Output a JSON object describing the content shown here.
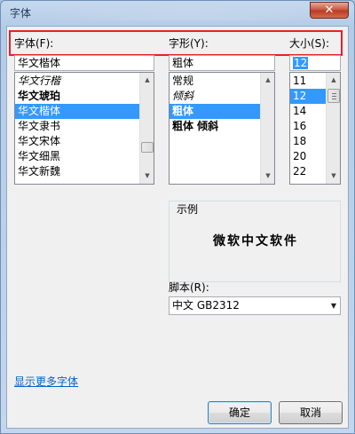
{
  "window": {
    "title": "字体",
    "close_glyph": "✕"
  },
  "labels": {
    "font": "字体(F):",
    "style": "字形(Y):",
    "size": "大小(S):",
    "preview": "示例",
    "script": "脚本(R):"
  },
  "font_input": "华文楷体",
  "style_input": "粗体",
  "size_input": "12",
  "font_list": [
    {
      "label": "华文行楷",
      "selected": false,
      "look": "script"
    },
    {
      "label": "华文琥珀",
      "selected": false,
      "look": "bold"
    },
    {
      "label": "华文楷体",
      "selected": true,
      "look": "normal"
    },
    {
      "label": "华文隶书",
      "selected": false,
      "look": "normal"
    },
    {
      "label": "华文宋体",
      "selected": false,
      "look": "normal"
    },
    {
      "label": "华文细黑",
      "selected": false,
      "look": "normal"
    },
    {
      "label": "华文新魏",
      "selected": false,
      "look": "normal"
    }
  ],
  "style_list": [
    {
      "label": "常规",
      "selected": false,
      "look": "normal"
    },
    {
      "label": "倾斜",
      "selected": false,
      "look": "script"
    },
    {
      "label": "粗体",
      "selected": true,
      "look": "bold"
    },
    {
      "label": "粗体 倾斜",
      "selected": false,
      "look": "bold"
    }
  ],
  "size_list": [
    {
      "label": "11",
      "selected": false
    },
    {
      "label": "12",
      "selected": true
    },
    {
      "label": "14",
      "selected": false
    },
    {
      "label": "16",
      "selected": false
    },
    {
      "label": "18",
      "selected": false
    },
    {
      "label": "20",
      "selected": false
    },
    {
      "label": "22",
      "selected": false
    }
  ],
  "preview_text": "微软中文软件",
  "script_value": "中文 GB2312",
  "more_fonts_link": "显示更多字体",
  "buttons": {
    "ok": "确定",
    "cancel": "取消"
  },
  "colors": {
    "highlight_border": "#e6202a",
    "selection": "#3399ff",
    "link": "#0066cc"
  },
  "icons": {
    "close": "close-icon",
    "scroll_up": "scroll-up-icon",
    "scroll_down": "scroll-down-icon",
    "dropdown": "chevron-down-icon"
  }
}
